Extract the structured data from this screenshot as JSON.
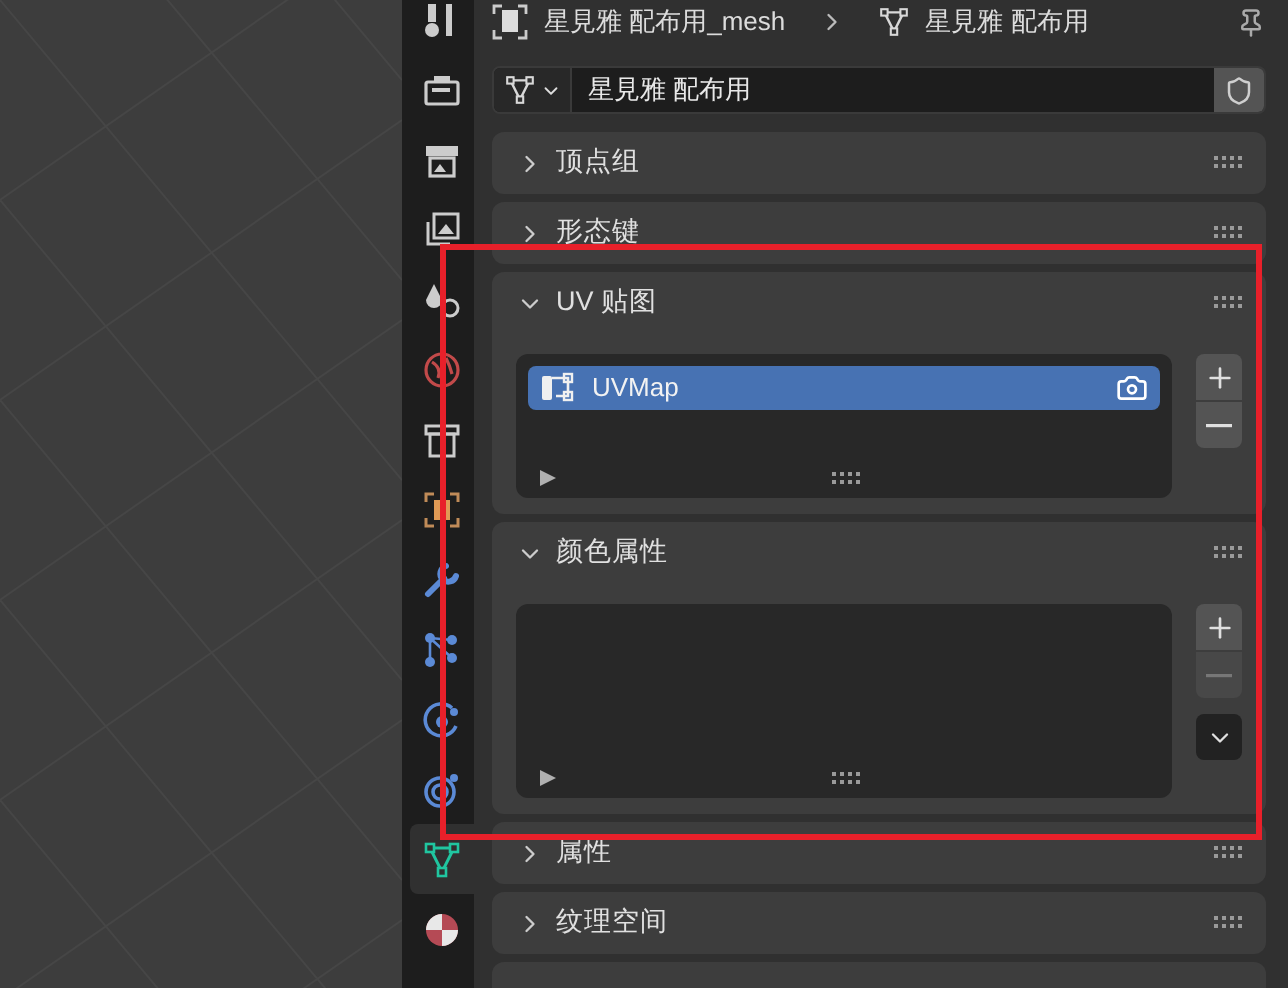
{
  "breadcrumb": {
    "items": [
      {
        "kind": "mesh_object",
        "label": "星見雅 配布用_mesh"
      },
      {
        "kind": "mesh_data",
        "label": "星見雅 配布用"
      }
    ]
  },
  "datablock": {
    "name": "星見雅 配布用"
  },
  "tabs": [
    {
      "kind": "tool",
      "selected": false
    },
    {
      "kind": "render",
      "selected": false
    },
    {
      "kind": "output",
      "selected": false
    },
    {
      "kind": "view_layer",
      "selected": false
    },
    {
      "kind": "scene",
      "selected": false
    },
    {
      "kind": "world",
      "selected": false
    },
    {
      "kind": "collection",
      "selected": false
    },
    {
      "kind": "object",
      "selected": false
    },
    {
      "kind": "modifier",
      "selected": false
    },
    {
      "kind": "particles",
      "selected": false
    },
    {
      "kind": "physics",
      "selected": false
    },
    {
      "kind": "constraints",
      "selected": false
    },
    {
      "kind": "data",
      "selected": true
    },
    {
      "kind": "material",
      "selected": false
    }
  ],
  "panels": [
    {
      "title": "顶点组",
      "expanded": false
    },
    {
      "title": "形态键",
      "expanded": false
    },
    {
      "title": "UV 贴图",
      "expanded": true,
      "list": {
        "items": [
          {
            "name": "UVMap",
            "selected": true
          }
        ],
        "remove_disabled": false,
        "has_menu": false
      }
    },
    {
      "title": "颜色属性",
      "expanded": true,
      "list": {
        "remove_disabled": true,
        "has_menu": true
      }
    },
    {
      "title": "属性",
      "expanded": false
    },
    {
      "title": "纹理空间",
      "expanded": false
    }
  ],
  "partial_panel_below": true,
  "annotation": {
    "kind": "rectangle",
    "color": "#e8202a"
  }
}
